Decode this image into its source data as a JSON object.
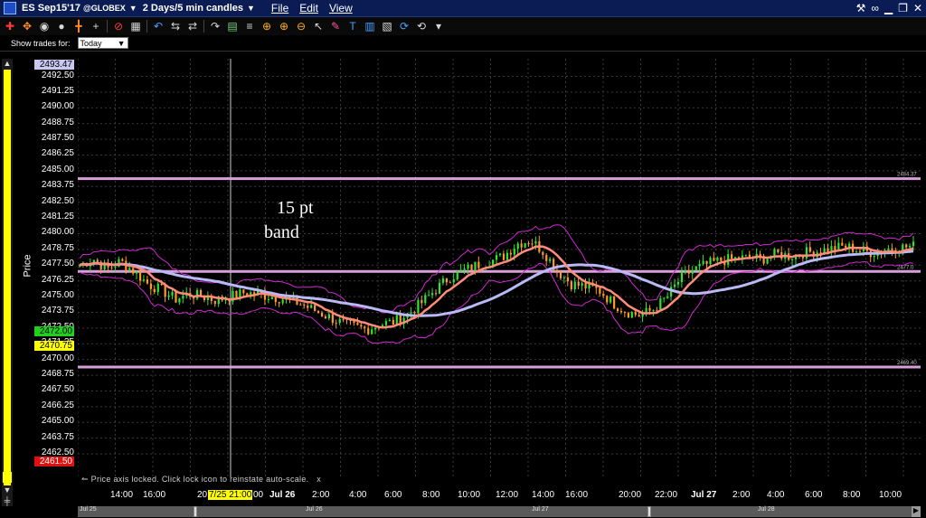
{
  "window": {
    "symbol": "ES Sep15'17",
    "exchange": "@GLOBEX",
    "range": "2 Days/5 min candles",
    "menus": [
      "File",
      "Edit",
      "View"
    ]
  },
  "toolbar": {
    "icons": [
      "crosshair-icon",
      "multi-arrow-icon",
      "globe-icon",
      "circle-icon",
      "plus-crosshair-icon",
      "plus-icon",
      "delete-icon",
      "grid-icon",
      "undo-icon",
      "arrows-icon",
      "arrows-icon",
      "redo-icon",
      "table-icon",
      "list-icon",
      "zoom-in-icon",
      "zoom-in-icon",
      "zoom-out-icon",
      "cursor-icon",
      "drawing-icon",
      "text-icon",
      "bars-icon",
      "layout-icon",
      "refresh-icon",
      "reset-icon",
      "dropdown-icon"
    ]
  },
  "trades": {
    "label": "Show trades for:",
    "value": "Today"
  },
  "axis": {
    "title": "Price",
    "ticks": [
      "2492.50",
      "2491.25",
      "2490.00",
      "2488.75",
      "2487.50",
      "2486.25",
      "2485.00",
      "2483.75",
      "2482.50",
      "2481.25",
      "2480.00",
      "2478.75",
      "2477.50",
      "2476.25",
      "2475.00",
      "2473.75",
      "2472.50",
      "2471.25",
      "2470.00",
      "2468.75",
      "2467.50",
      "2466.25",
      "2465.00",
      "2463.75",
      "2462.50"
    ],
    "high_label": "2493.47",
    "last_label": "2472.00",
    "yellow_label": "2470.75",
    "low_label": "2461.50",
    "right_labels": [
      "2484.37",
      "2477.0",
      "2469.40"
    ],
    "status_message": "Price axis locked. Click lock icon to reinstate auto-scale.",
    "status_close": "x"
  },
  "annotation": {
    "line1": "15 pt",
    "line2": "band"
  },
  "time_axis": {
    "labels": [
      "14:00",
      "16:00",
      "20",
      "7/25 21:00",
      "00",
      "Jul 26",
      "2:00",
      "4:00",
      "6:00",
      "8:00",
      "10:00",
      "12:00",
      "14:00",
      "16:00",
      "20:00",
      "22:00",
      "Jul 27",
      "2:00",
      "4:00",
      "6:00",
      "8:00",
      "10:00"
    ]
  },
  "navigator": {
    "dates": [
      "Jul 25",
      "Jul 26",
      "Jul 27",
      "Jul 28"
    ]
  },
  "colors": {
    "title_bg": "#0b1c55",
    "candle_up": "#2ee62e",
    "candle_down": "#ff9a2a",
    "ma_fast": "#ff8c7a",
    "ma_slow": "#b9b9f5",
    "band": "#d028d0",
    "hline": "#d8a0d8"
  },
  "chart_data": {
    "type": "candlestick",
    "ylim": [
      2461.5,
      2493.47
    ],
    "hlines": [
      2484.37,
      2477.0,
      2469.4
    ],
    "price_path": [
      2477.5,
      2478.0,
      2477.2,
      2477.8,
      2477.0,
      2476.0,
      2475.5,
      2474.8,
      2475.2,
      2475.0,
      2474.7,
      2475.0,
      2475.3,
      2475.2,
      2475.0,
      2474.8,
      2474.5,
      2474.0,
      2473.5,
      2473.0,
      2472.6,
      2472.4,
      2472.8,
      2473.0,
      2473.6,
      2474.5,
      2475.5,
      2476.5,
      2477.0,
      2477.5,
      2477.8,
      2478.2,
      2479.2,
      2479.5,
      2478.5,
      2477.0,
      2476.0,
      2475.8,
      2475.5,
      2474.5,
      2473.8,
      2473.5,
      2474.0,
      2475.0,
      2476.5,
      2477.2,
      2477.6,
      2477.9,
      2478.0,
      2478.1,
      2478.0,
      2478.4,
      2478.2,
      2478.5,
      2478.6,
      2478.8,
      2479.0,
      2478.7,
      2478.5,
      2478.8,
      2478.9,
      2479.0
    ]
  }
}
